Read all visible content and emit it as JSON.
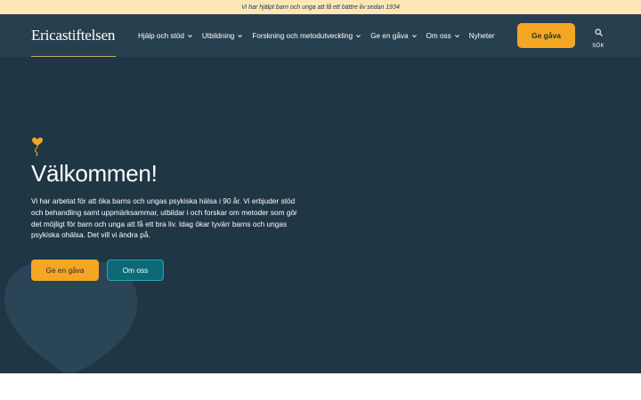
{
  "announcement": "Vi har hjälpt barn och unga att få ett bättre liv sedan 1934",
  "header": {
    "logo": "Ericastiftelsen",
    "nav": [
      {
        "label": "Hjälp och stöd",
        "dropdown": true
      },
      {
        "label": "Utbildning",
        "dropdown": true
      },
      {
        "label": "Forskning och metodutveckling",
        "dropdown": true
      },
      {
        "label": "Ge en gåva",
        "dropdown": true
      },
      {
        "label": "Om oss",
        "dropdown": true
      },
      {
        "label": "Nyheter",
        "dropdown": false
      }
    ],
    "cta": "Ge gåva",
    "search_label": "SÖK",
    "search_icon": "search-icon"
  },
  "hero": {
    "title": "Välkommen!",
    "text": "Vi har arbetat för att öka barns och ungas psykiska hälsa i 90 år. Vi erbjuder stöd och behandling samt uppmärksammar, utbildar i och forskar om metoder som gör det möjligt för barn och unga att få ett bra liv. Idag ökar tyvärr barns och ungas psykiska ohälsa. Det vill vi ändra på.",
    "primary_button": "Ge en gåva",
    "secondary_button": "Om oss",
    "balloon_icon": "heart-balloon-icon"
  },
  "colors": {
    "announcement_bg": "#fde7b6",
    "header_bg": "#27404f",
    "hero_bg": "#1f3645",
    "accent": "#f5a623",
    "teal_button": "#0b6a76"
  }
}
